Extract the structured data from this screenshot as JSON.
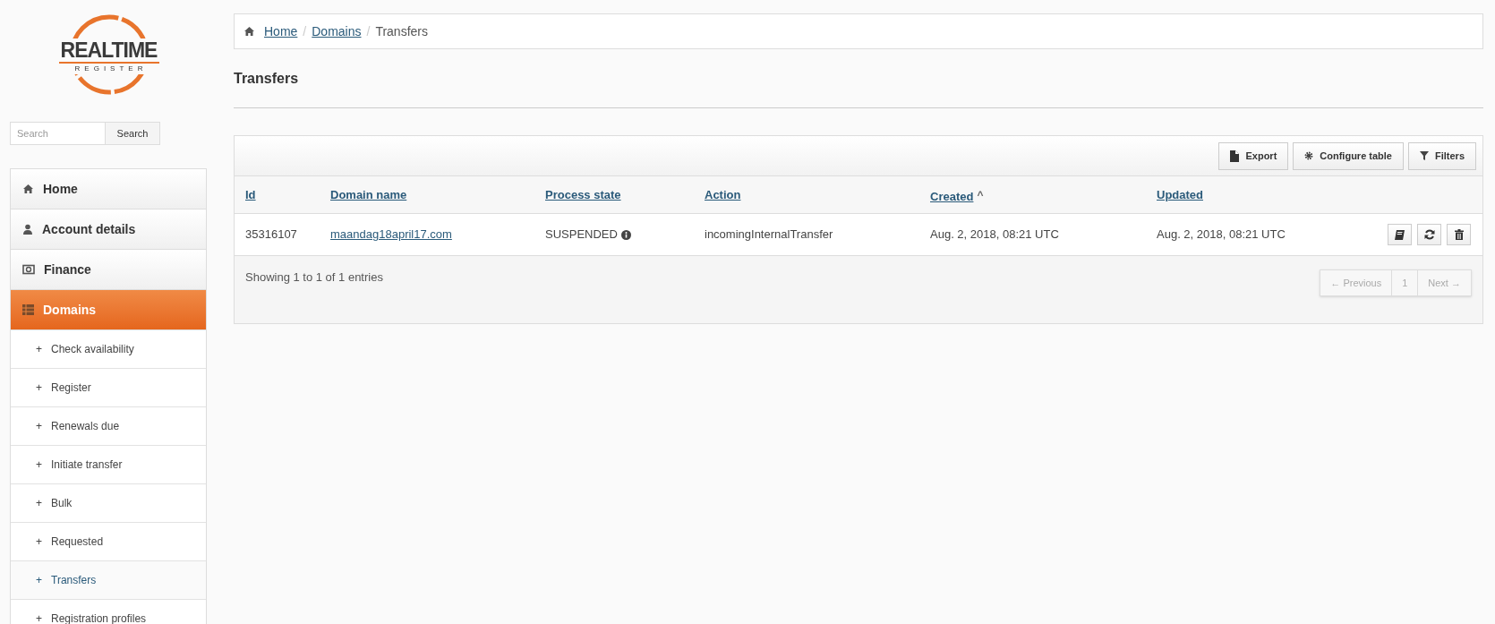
{
  "logo": {
    "line_1": "REALTIME",
    "line_2": "REGISTER"
  },
  "search": {
    "placeholder": "Search",
    "button": "Search"
  },
  "nav": [
    {
      "label": "Home",
      "kind": "home",
      "selected": false
    },
    {
      "label": "Account details",
      "kind": "user",
      "selected": false
    },
    {
      "label": "Finance",
      "kind": "money",
      "selected": false
    },
    {
      "label": "Domains",
      "kind": "list",
      "selected": true
    }
  ],
  "subnav": [
    {
      "marker": "+",
      "label": "Check availability",
      "selected": false
    },
    {
      "marker": "+",
      "label": "Register",
      "selected": false
    },
    {
      "marker": "+",
      "label": "Renewals due",
      "selected": false
    },
    {
      "marker": "+",
      "label": "Initiate transfer",
      "selected": false
    },
    {
      "marker": "+",
      "label": "Bulk",
      "selected": false
    },
    {
      "marker": "+",
      "label": "Requested",
      "selected": false
    },
    {
      "marker": "+",
      "label": "Transfers",
      "selected": true
    },
    {
      "marker": "+",
      "label": "Registration profiles",
      "selected": false
    }
  ],
  "breadcrumb": [
    {
      "label": "Home",
      "link": true
    },
    {
      "label": "Domains",
      "link": true
    },
    {
      "label": "Transfers",
      "link": false
    }
  ],
  "breadcrumb_separator": "/",
  "page_title": "Transfers",
  "toolbar": [
    {
      "label": "Export",
      "kind": "file"
    },
    {
      "label": "Configure table",
      "kind": "gear"
    },
    {
      "label": "Filters",
      "kind": "filter"
    }
  ],
  "table": {
    "columns": [
      {
        "label": "Id"
      },
      {
        "label": "Domain name"
      },
      {
        "label": "Process state"
      },
      {
        "label": "Action"
      },
      {
        "label": "Created",
        "sort_indicator": "^"
      },
      {
        "label": "Updated"
      }
    ],
    "rows": [
      {
        "id": "35316107",
        "domain_name": "maandag18april17.com",
        "process_state": "SUSPENDED",
        "action": "incomingInternalTransfer",
        "created": "Aug. 2, 2018, 08:21 UTC",
        "updated": "Aug. 2, 2018, 08:21 UTC",
        "row_actions": [
          {
            "kind": "book"
          },
          {
            "kind": "refresh"
          },
          {
            "kind": "trash"
          }
        ]
      }
    ],
    "summary": "Showing 1 to 1 of 1 entries"
  },
  "pagination": [
    {
      "label": "← Previous",
      "disabled": true
    },
    {
      "label": "1",
      "disabled": true
    },
    {
      "label": "Next →",
      "disabled": true
    }
  ]
}
